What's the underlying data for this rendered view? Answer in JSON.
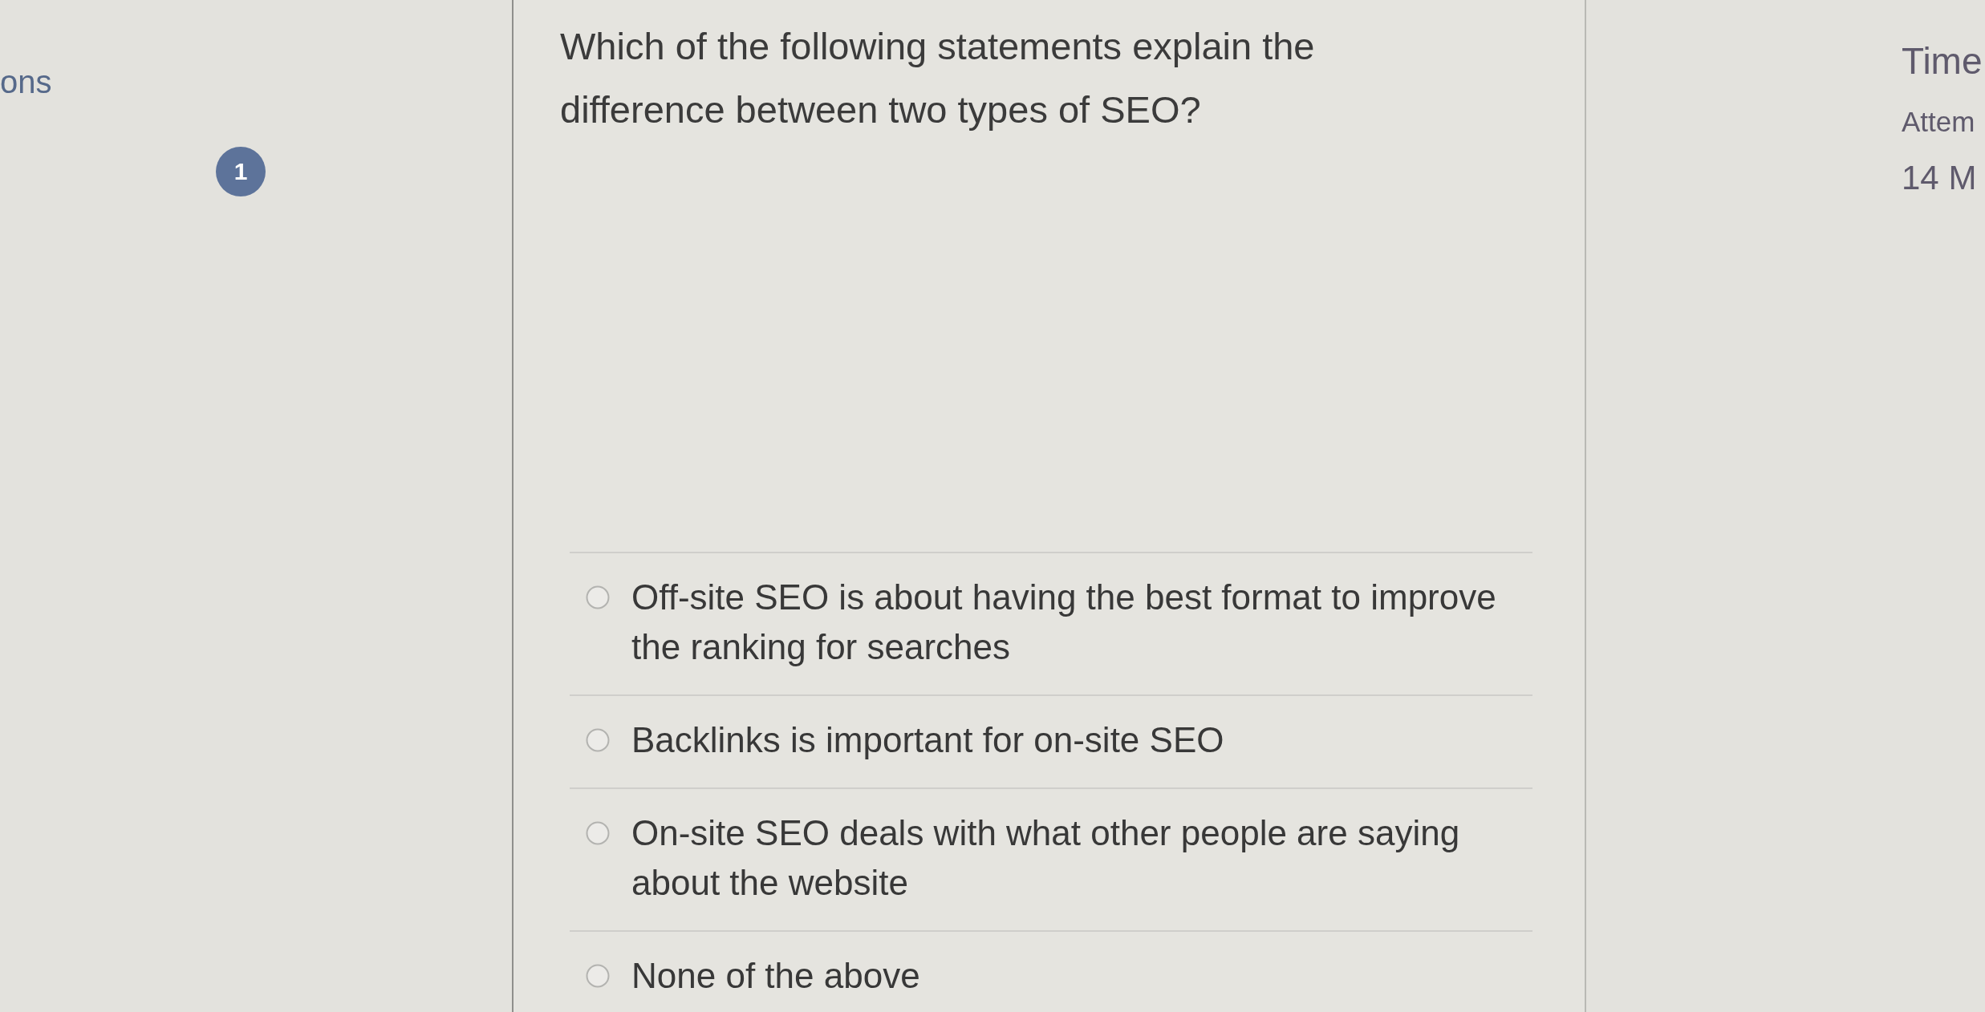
{
  "sidebar": {
    "heading": "ons",
    "questions": [
      {
        "number": "1"
      }
    ]
  },
  "question": {
    "text": "Which of the following statements explain the difference between two types of SEO?",
    "options": [
      {
        "label": "Off-site SEO is about having the best format to improve the ranking for searches",
        "selected": false
      },
      {
        "label": "Backlinks is important for on-site SEO",
        "selected": false
      },
      {
        "label": "On-site SEO deals with what other people are saying about the website",
        "selected": false
      },
      {
        "label": "None of the above",
        "selected": false
      }
    ]
  },
  "info": {
    "lines": [
      {
        "kind": "title",
        "text": "Time"
      },
      {
        "kind": "label",
        "text": "Attem"
      },
      {
        "kind": "value",
        "text": "14 M"
      }
    ]
  }
}
